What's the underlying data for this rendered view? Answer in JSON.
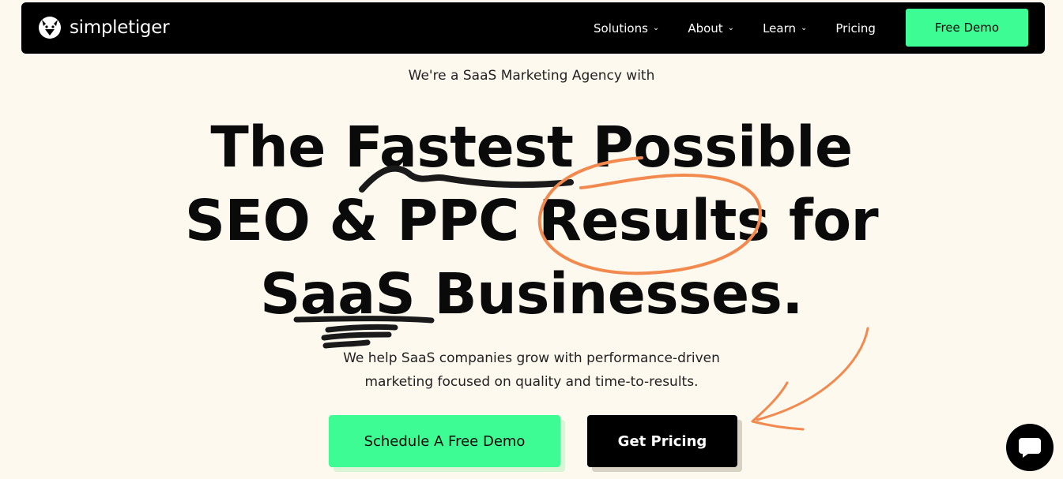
{
  "brand": {
    "name": "simpletiger",
    "logo_icon": "tiger-head-icon"
  },
  "nav": {
    "items": [
      {
        "label": "Solutions",
        "has_dropdown": true
      },
      {
        "label": "About",
        "has_dropdown": true
      },
      {
        "label": "Learn",
        "has_dropdown": true
      },
      {
        "label": "Pricing",
        "has_dropdown": false
      }
    ],
    "cta_label": "Free Demo"
  },
  "hero": {
    "kicker": "We're a SaaS Marketing Agency with",
    "headline_lines": [
      "The Fastest Possible",
      "SEO & PPC Results for",
      "SaaS Businesses."
    ],
    "sub_lines": [
      "We help SaaS companies grow with performance-driven",
      "marketing focused on quality and time-to-results."
    ],
    "primary_cta": "Schedule A Free Demo",
    "secondary_cta": "Get Pricing"
  },
  "chat": {
    "icon": "chat-bubble-icon"
  },
  "colors": {
    "accent": "#3dfc93",
    "background": "#fdf9ee",
    "scribble": "#f28a4f",
    "dark": "#000000"
  }
}
